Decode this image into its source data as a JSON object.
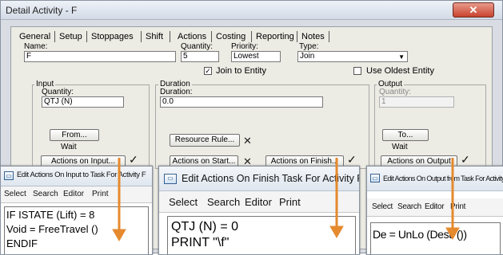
{
  "window": {
    "title": "Detail Activity - F",
    "close_icon": "close-icon"
  },
  "tabs": [
    "General",
    "Setup",
    "Stoppages",
    "Shift",
    "Actions",
    "Costing",
    "Reporting",
    "Notes"
  ],
  "general": {
    "name_label": "Name:",
    "name_value": "F",
    "quantity_label": "Quantity:",
    "quantity_value": "5",
    "priority_label": "Priority:",
    "priority_value": "Lowest",
    "type_label": "Type:",
    "type_value": "Join",
    "join_to_entity_label": "Join to Entity",
    "join_to_entity_checked": true,
    "use_oldest_label": "Use Oldest Entity",
    "use_oldest_checked": false
  },
  "input": {
    "group_label": "Input",
    "quantity_label": "Quantity:",
    "quantity_value": "QTJ (N)",
    "from_button": "From...",
    "wait_label": "Wait",
    "actions_button": "Actions on Input..."
  },
  "duration": {
    "group_label": "Duration",
    "duration_label": "Duration:",
    "duration_value": "0.0",
    "resource_rule_button": "Resource Rule...",
    "actions_start_button": "Actions on Start...",
    "actions_finish_button": "Actions on Finish..."
  },
  "output": {
    "group_label": "Output",
    "quantity_label": "Quantity:",
    "quantity_value": "1",
    "to_button": "To...",
    "wait_label": "Wait",
    "actions_button": "Actions on Output"
  },
  "editors": [
    {
      "title": "Edit Actions On Input to Task  For Activity F",
      "menu": [
        "Select",
        "Search",
        "Editor",
        "Print"
      ],
      "code": [
        "IF ISTATE (Lift) = 8",
        "Void = FreeTravel ()",
        "ENDIF"
      ]
    },
    {
      "title": "Edit Actions On Finish Task For Activity F",
      "menu": [
        "Select",
        "Search",
        "Editor",
        "Print"
      ],
      "code": [
        "QTJ (N) = 0",
        "PRINT \"\\f\""
      ]
    },
    {
      "title": "Edit Actions On Output from Task  For Activity F",
      "menu": [
        "Select",
        "Search",
        "Editor",
        "Print"
      ],
      "code": [
        "De = UnLo (Desti ())"
      ]
    }
  ],
  "colors": {
    "arrow": "#e58a2e",
    "title_bar": "#d3dbe6",
    "close_button": "#c8432e"
  }
}
